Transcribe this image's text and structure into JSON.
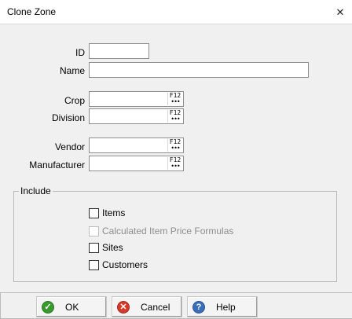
{
  "window": {
    "title": "Clone Zone",
    "close_glyph": "✕"
  },
  "fields": {
    "id": {
      "label": "ID",
      "value": ""
    },
    "name": {
      "label": "Name",
      "value": ""
    },
    "crop": {
      "label": "Crop",
      "value": "",
      "lookup_key": "F12"
    },
    "division": {
      "label": "Division",
      "value": "",
      "lookup_key": "F12"
    },
    "vendor": {
      "label": "Vendor",
      "value": "",
      "lookup_key": "F12"
    },
    "manufacturer": {
      "label": "Manufacturer",
      "value": "",
      "lookup_key": "F12"
    }
  },
  "include": {
    "legend": "Include",
    "options": [
      {
        "label": "Items",
        "checked": false,
        "enabled": true
      },
      {
        "label": "Calculated Item Price Formulas",
        "checked": false,
        "enabled": false
      },
      {
        "label": "Sites",
        "checked": false,
        "enabled": true
      },
      {
        "label": "Customers",
        "checked": false,
        "enabled": true
      }
    ]
  },
  "buttons": {
    "ok": {
      "label": "OK",
      "icon": "check-icon"
    },
    "cancel": {
      "label": "Cancel",
      "icon": "cancel-icon"
    },
    "help": {
      "label": "Help",
      "icon": "help-icon"
    }
  },
  "colors": {
    "ok_icon": "#3a9a2d",
    "cancel_icon": "#d23b2a",
    "help_icon": "#3a6fb8",
    "disabled_text": "#8d8d8d"
  }
}
